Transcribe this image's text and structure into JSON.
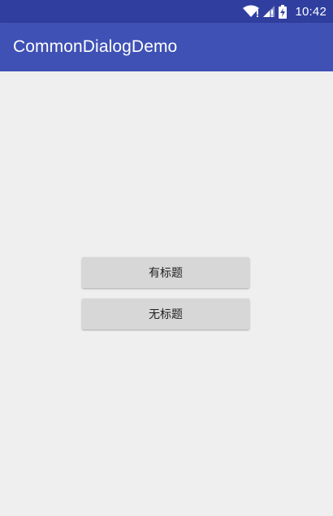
{
  "status_bar": {
    "time": "10:42",
    "icons": [
      "wifi-icon",
      "signal-icon",
      "battery-charging-icon"
    ]
  },
  "app_bar": {
    "title": "CommonDialogDemo",
    "color": "#3f51b5"
  },
  "buttons": {
    "with_title_label": "有标题",
    "without_title_label": "无标题"
  },
  "colors": {
    "status_bar": "#303f9f",
    "background": "#efefef",
    "button": "#d7d7d7"
  }
}
